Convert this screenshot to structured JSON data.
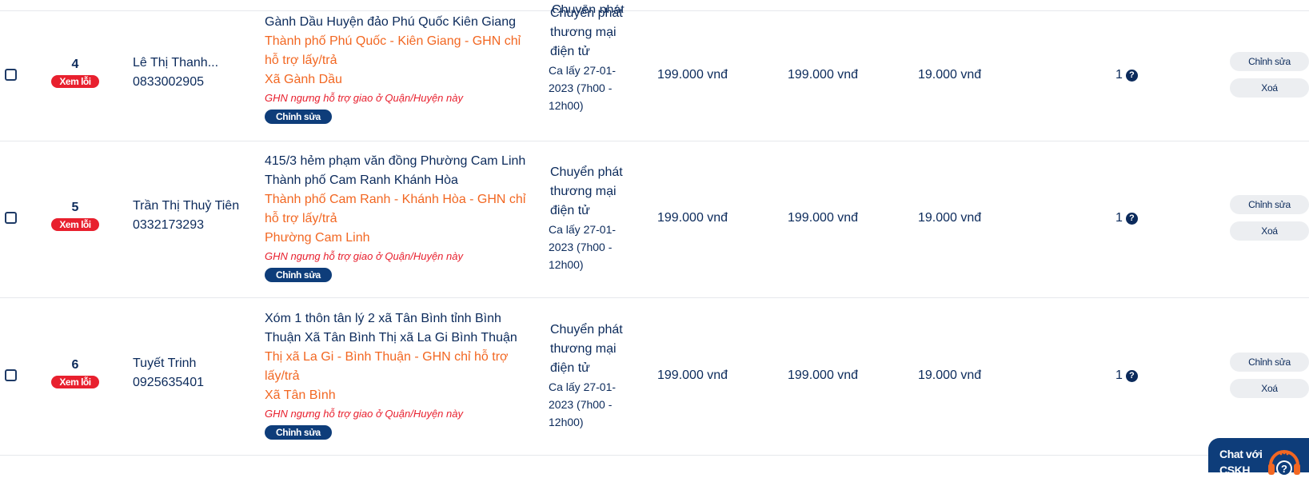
{
  "rows": [
    {
      "index": "4",
      "error_badge": "Xem lỗi",
      "customer_name": "Lê Thị Thanh...",
      "customer_phone": "0833002905",
      "address_lines": [
        "Gành Dầu Huyện đảo Phú Quốc Kiên Giang"
      ],
      "address_area_lines": [
        "Thành phố Phú Quốc - Kiên Giang - GHN chỉ",
        "hỗ trợ lấy/trả",
        "Xã Gành Dầu"
      ],
      "address_warning": "GHN ngưng hỗ trợ giao ở Quận/Huyện này",
      "address_edit": "Chỉnh sửa",
      "service_lines": [
        "Chuyển phát",
        "thương mại",
        "điện tử"
      ],
      "shift_lines": [
        "Ca lấy 27-01-",
        "2023 (7h00 -",
        "12h00)"
      ],
      "cod": "199.000 vnđ",
      "value": "199.000 vnđ",
      "fee": "19.000 vnđ",
      "quantity": "1",
      "edit_button": "Chỉnh sửa",
      "delete_button": "Xoá"
    },
    {
      "index": "5",
      "error_badge": "Xem lỗi",
      "customer_name": "Trần Thị Thuỷ Tiên",
      "customer_phone": "0332173293",
      "address_lines": [
        "415/3 hẻm phạm văn đồng Phường Cam Linh",
        "Thành phố Cam Ranh Khánh Hòa"
      ],
      "address_area_lines": [
        "Thành phố Cam Ranh - Khánh Hòa - GHN chỉ",
        "hỗ trợ lấy/trả",
        "Phường Cam Linh"
      ],
      "address_warning": "GHN ngưng hỗ trợ giao ở Quận/Huyện này",
      "address_edit": "Chỉnh sửa",
      "service_lines": [
        "Chuyển phát",
        "thương mại",
        "điện tử"
      ],
      "shift_lines": [
        "Ca lấy 27-01-",
        "2023 (7h00 -",
        "12h00)"
      ],
      "cod": "199.000 vnđ",
      "value": "199.000 vnđ",
      "fee": "19.000 vnđ",
      "quantity": "1",
      "edit_button": "Chỉnh sửa",
      "delete_button": "Xoá"
    },
    {
      "index": "6",
      "error_badge": "Xem lỗi",
      "customer_name": "Tuyết Trinh",
      "customer_phone": "0925635401",
      "address_lines": [
        "Xóm 1 thôn tân lý 2 xã Tân Bình tỉnh Bình",
        "Thuận Xã Tân Bình Thị xã La Gi Bình Thuận"
      ],
      "address_area_lines": [
        "Thị xã La Gi - Bình Thuận - GHN chỉ hỗ trợ",
        "lấy/trả",
        "Xã Tân Bình"
      ],
      "address_warning": "GHN ngưng hỗ trợ giao ở Quận/Huyện này",
      "address_edit": "Chỉnh sửa",
      "service_lines": [
        "Chuyển phát",
        "thương mại",
        "điện tử"
      ],
      "shift_lines": [
        "Ca lấy 27-01-",
        "2023 (7h00 -",
        "12h00)"
      ],
      "cod": "199.000 vnđ",
      "value": "199.000 vnđ",
      "fee": "19.000 vnđ",
      "quantity": "1",
      "edit_button": "Chỉnh sửa",
      "delete_button": "Xoá"
    }
  ],
  "partial_top": {
    "service_line": "Chuyển phát"
  },
  "chat_widget": {
    "label_line1": "Chat với",
    "label_line2": "CSKH",
    "icon": "headset-icon"
  },
  "colors": {
    "primary": "#0b2a5b",
    "accent_orange": "#f26722",
    "error_red": "#e8202e",
    "pill_navy": "#0e3d7a"
  }
}
